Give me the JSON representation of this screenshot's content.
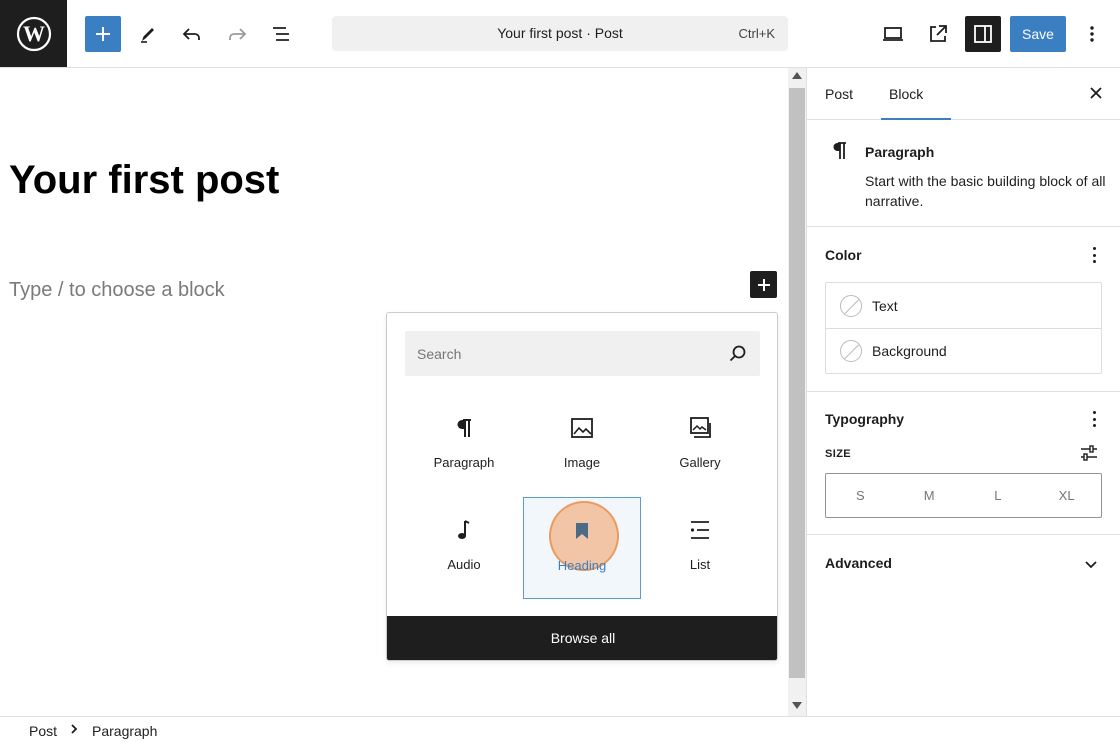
{
  "toolbar": {
    "document_title": "Your first post · Post",
    "shortcut": "Ctrl+K",
    "save_label": "Save",
    "accent_color": "#3a7fc1"
  },
  "editor": {
    "post_title": "Your first post",
    "block_placeholder": "Type / to choose a block"
  },
  "inserter": {
    "search_placeholder": "Search",
    "blocks": [
      {
        "label": "Paragraph",
        "icon": "paragraph-icon"
      },
      {
        "label": "Image",
        "icon": "image-icon"
      },
      {
        "label": "Gallery",
        "icon": "gallery-icon"
      },
      {
        "label": "Audio",
        "icon": "audio-icon"
      },
      {
        "label": "Heading",
        "icon": "heading-bookmark-icon",
        "selected": true
      },
      {
        "label": "List",
        "icon": "list-icon"
      }
    ],
    "browse_all_label": "Browse all"
  },
  "sidebar": {
    "tabs": [
      "Post",
      "Block"
    ],
    "active_tab": "Block",
    "block_card": {
      "name": "Paragraph",
      "description": "Start with the basic building block of all narrative."
    },
    "color_panel": {
      "title": "Color",
      "items": [
        "Text",
        "Background"
      ]
    },
    "typography_panel": {
      "title": "Typography",
      "size_label": "SIZE",
      "sizes": [
        "S",
        "M",
        "L",
        "XL"
      ]
    },
    "advanced_panel": {
      "title": "Advanced"
    }
  },
  "breadcrumb": [
    "Post",
    "Paragraph"
  ]
}
